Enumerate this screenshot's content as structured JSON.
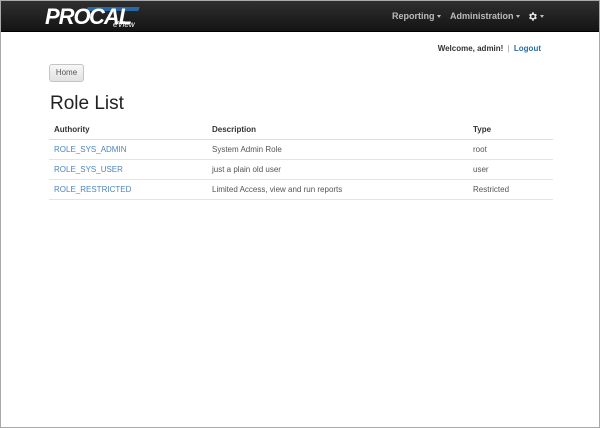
{
  "brand": {
    "pro": "PRO",
    "cal": "CAL",
    "sub": "eView"
  },
  "nav": {
    "reporting": "Reporting",
    "administration": "Administration",
    "settings_icon": "gear-icon"
  },
  "welcome": {
    "text": "Welcome, admin!",
    "separator": "|",
    "logout": "Logout"
  },
  "breadcrumb": {
    "home": "Home"
  },
  "page": {
    "title": "Role List"
  },
  "table": {
    "headers": [
      "Authority",
      "Description",
      "Type"
    ],
    "rows": [
      {
        "authority": "ROLE_SYS_ADMIN",
        "description": "System Admin Role",
        "type": "root"
      },
      {
        "authority": "ROLE_SYS_USER",
        "description": "just a plain old user",
        "type": "user"
      },
      {
        "authority": "ROLE_RESTRICTED",
        "description": "Limited Access, view and run reports",
        "type": "Restricted"
      }
    ]
  },
  "colors": {
    "navbar": "#1e1e1e",
    "link": "#4e85bc",
    "accent": "#2b6fb6"
  }
}
